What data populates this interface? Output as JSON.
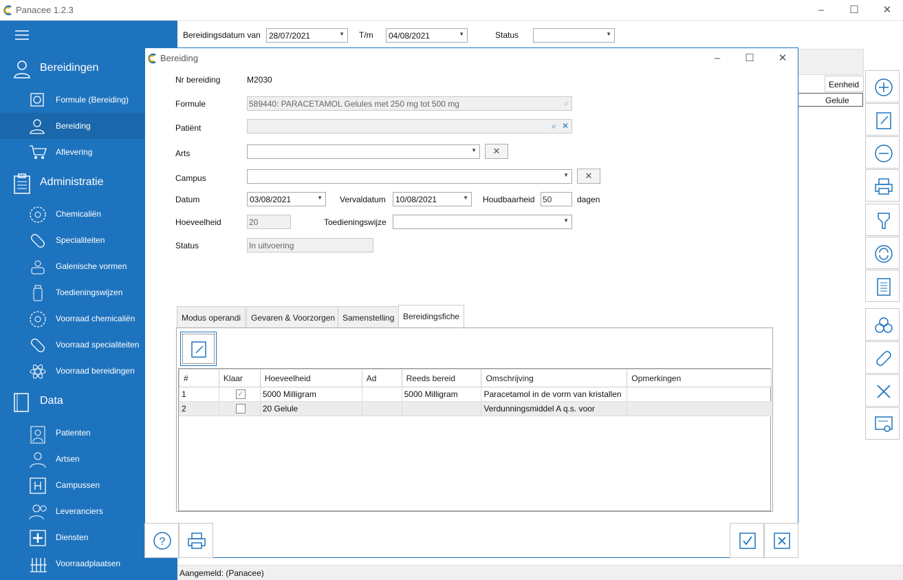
{
  "app": {
    "title": "Panacee 1.2.3",
    "min_icon": "minimize-icon",
    "max_icon": "maximize-icon",
    "close_icon": "close-icon"
  },
  "sidebar": {
    "sections": [
      {
        "label": "Bereidingen",
        "icon": "person-icon",
        "items": [
          {
            "label": "Formule (Bereiding)",
            "icon": "formula-icon"
          },
          {
            "label": "Bereiding",
            "icon": "person-icon",
            "active": true
          },
          {
            "label": "Aflevering",
            "icon": "cart-icon"
          }
        ]
      },
      {
        "label": "Administratie",
        "icon": "clipboard-icon",
        "items": [
          {
            "label": "Chemicaliën",
            "icon": "molecule-icon"
          },
          {
            "label": "Specialiteiten",
            "icon": "pill-icon"
          },
          {
            "label": "Galenische vormen",
            "icon": "galenic-icon"
          },
          {
            "label": "Toedieningswijzen",
            "icon": "bottle-icon"
          },
          {
            "label": "Voorraad chemicaliën",
            "icon": "molecule-icon"
          },
          {
            "label": "Voorraad specialiteiten",
            "icon": "pill-icon"
          },
          {
            "label": "Voorraad bereidingen",
            "icon": "atom-icon"
          }
        ]
      },
      {
        "label": "Data",
        "icon": "book-icon",
        "items": [
          {
            "label": "Patienten",
            "icon": "patient-icon"
          },
          {
            "label": "Artsen",
            "icon": "doctor-icon"
          },
          {
            "label": "Campussen",
            "icon": "hospital-icon"
          },
          {
            "label": "Leveranciers",
            "icon": "suppliers-icon"
          },
          {
            "label": "Diensten",
            "icon": "cross-icon"
          },
          {
            "label": "Voorraadplaatsen",
            "icon": "shelves-icon"
          }
        ]
      }
    ]
  },
  "filter": {
    "from_label": "Bereidingsdatum van",
    "from_value": "28/07/2021",
    "to_label": "T/m",
    "to_value": "04/08/2021",
    "status_label": "Status",
    "status_value": ""
  },
  "background_grid": {
    "header": "Eenheid",
    "cell": "Gelule"
  },
  "right_toolbar": [
    "plus-icon",
    "edit-icon",
    "minus-icon",
    "print-icon",
    "funnel-icon",
    "refresh-icon",
    "document-icon",
    "biohazard-icon",
    "pill-icon",
    "close-icon",
    "certificate-icon"
  ],
  "dialog": {
    "title": "Bereiding",
    "fields": {
      "nr_label": "Nr bereiding",
      "nr_value": "M2030",
      "formule_label": "Formule",
      "formule_value": "589440: PARACETAMOL Gelules met 250 mg tot 500 mg",
      "patient_label": "Patiënt",
      "patient_value": "",
      "arts_label": "Arts",
      "arts_value": "",
      "campus_label": "Campus",
      "campus_value": "",
      "datum_label": "Datum",
      "datum_value": "03/08/2021",
      "vervaldatum_label": "Vervaldatum",
      "vervaldatum_value": "10/08/2021",
      "houdbaarheid_label": "Houdbaarheid",
      "houdbaarheid_value": "50",
      "houdbaarheid_unit": "dagen",
      "hoeveelheid_label": "Hoeveelheid",
      "hoeveelheid_value": "20",
      "toediening_label": "Toedieningswijze",
      "toediening_value": "",
      "status_label": "Status",
      "status_value": "In uitvoering"
    },
    "tabs": [
      "Modus operandi",
      "Gevaren & Voorzorgen",
      "Samenstelling",
      "Bereidingsfiche"
    ],
    "active_tab": "Bereidingsfiche",
    "grid": {
      "columns": [
        "#",
        "Klaar",
        "Hoeveelheid",
        "Ad",
        "Reeds bereid",
        "Omschrijving",
        "Opmerkingen"
      ],
      "rows": [
        {
          "num": "1",
          "klaar": true,
          "hoeveelheid": "5000 Milligram",
          "ad": "",
          "reeds": "5000 Milligram",
          "omschrijving": "Paracetamol in de vorm van kristallen",
          "opmerkingen": ""
        },
        {
          "num": "2",
          "klaar": false,
          "hoeveelheid": "20 Gelule",
          "ad": "",
          "reeds": "",
          "omschrijving": "Verdunningsmiddel A q.s. voor",
          "opmerkingen": ""
        }
      ]
    }
  },
  "statusbar": {
    "text": "Aangemeld:  (Panacee)"
  },
  "colors": {
    "sidebar": "#1e73be",
    "active_item": "#1a67ab",
    "accent": "#1e73be"
  }
}
